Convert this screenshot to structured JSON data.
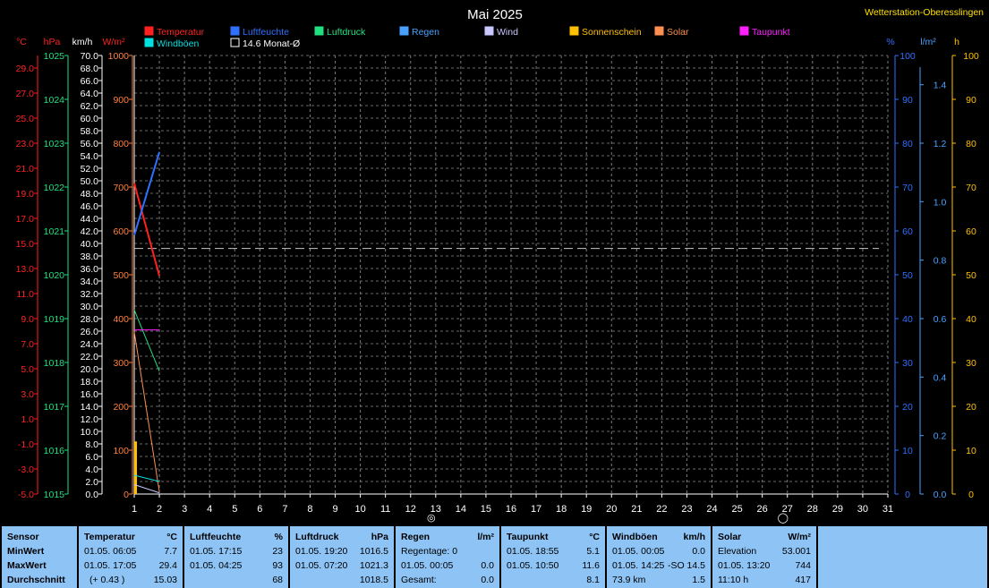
{
  "chart_data": {
    "type": "line",
    "title": "Mai 2025",
    "station": "Wetterstation-Oberesslingen",
    "x": {
      "categories": [
        "1",
        "2",
        "3",
        "4",
        "5",
        "6",
        "7",
        "8",
        "9",
        "10",
        "11",
        "12",
        "13",
        "14",
        "15",
        "16",
        "17",
        "18",
        "19",
        "20",
        "21",
        "22",
        "23",
        "24",
        "25",
        "26",
        "27",
        "28",
        "29",
        "30",
        "31"
      ],
      "range": [
        1,
        31
      ]
    },
    "axes_left": [
      {
        "unit": "°C",
        "color": "#ff2020",
        "min": -5,
        "max": 30,
        "ticks": [
          "-5.0",
          "-3.0",
          "-1.0",
          "1.0",
          "3.0",
          "5.0",
          "7.0",
          "9.0",
          "11.0",
          "13.0",
          "15.0",
          "17.0",
          "19.0",
          "21.0",
          "23.0",
          "25.0",
          "27.0",
          "29.0"
        ]
      },
      {
        "unit": "hPa",
        "color": "#20e080",
        "min": 1015,
        "max": 1025,
        "ticks": [
          "1015",
          "1016",
          "1017",
          "1018",
          "1019",
          "1020",
          "1021",
          "1022",
          "1023",
          "1024",
          "1025"
        ]
      },
      {
        "unit": "km/h",
        "color": "#ffffff",
        "min": 0,
        "max": 70,
        "ticks": [
          "0.0",
          "2.0",
          "4.0",
          "6.0",
          "8.0",
          "10.0",
          "12.0",
          "14.0",
          "16.0",
          "18.0",
          "20.0",
          "22.0",
          "24.0",
          "26.0",
          "28.0",
          "30.0",
          "32.0",
          "34.0",
          "36.0",
          "38.0",
          "40.0",
          "42.0",
          "44.0",
          "46.0",
          "48.0",
          "50.0",
          "52.0",
          "54.0",
          "56.0",
          "58.0",
          "60.0",
          "62.0",
          "64.0",
          "66.0",
          "68.0",
          "70.0"
        ]
      },
      {
        "unit": "W/m²",
        "color": "#ff8040",
        "min": 0,
        "max": 1000,
        "ticks": [
          "0",
          "100",
          "200",
          "300",
          "400",
          "500",
          "600",
          "700",
          "800",
          "900",
          "1000"
        ]
      }
    ],
    "axes_right": [
      {
        "unit": "%",
        "color": "#3070ff",
        "min": 0,
        "max": 100,
        "ticks": [
          "0",
          "10",
          "20",
          "30",
          "40",
          "50",
          "60",
          "70",
          "80",
          "90",
          "100"
        ]
      },
      {
        "unit": "l/m²",
        "color": "#4aa0ff",
        "min": 0,
        "max": 1.5,
        "ticks": [
          "0.0",
          "0.2",
          "0.4",
          "0.6",
          "0.8",
          "1.0",
          "1.2",
          "1.4"
        ]
      },
      {
        "unit": "h",
        "color": "#ffc000",
        "min": 0,
        "max": 100,
        "ticks": [
          "0",
          "10",
          "20",
          "30",
          "40",
          "50",
          "60",
          "70",
          "80",
          "90",
          "100"
        ]
      }
    ],
    "legend": [
      {
        "name": "Temperatur",
        "color": "#ff2020"
      },
      {
        "name": "Luftfeuchte",
        "color": "#3070ff"
      },
      {
        "name": "Luftdruck",
        "color": "#20e080"
      },
      {
        "name": "Regen",
        "color": "#4aa0ff"
      },
      {
        "name": "Wind",
        "color": "#c8c8ff"
      },
      {
        "name": "Sonnenschein",
        "color": "#ffc000"
      },
      {
        "name": "Solar",
        "color": "#ff9050"
      },
      {
        "name": "Taupunkt",
        "color": "#ff20ff"
      },
      {
        "name": "Windböen",
        "color": "#00e0e0"
      },
      {
        "name": "14.6 Monat-Ø",
        "color": "#000000"
      }
    ],
    "series": [
      {
        "name": "Temperatur",
        "axis": "°C",
        "x": [
          1,
          2
        ],
        "y": [
          19.8,
          12.4
        ]
      },
      {
        "name": "Luftfeuchte",
        "axis": "%",
        "x": [
          1,
          2
        ],
        "y": [
          59,
          78
        ]
      },
      {
        "name": "Luftdruck",
        "axis": "hPa",
        "x": [
          1,
          2
        ],
        "y": [
          1019.2,
          1017.8
        ]
      },
      {
        "name": "Solar",
        "axis": "W/m²",
        "x": [
          1,
          2
        ],
        "y": [
          370,
          5
        ]
      },
      {
        "name": "Windböen",
        "axis": "km/h",
        "x": [
          1,
          2
        ],
        "y": [
          3.0,
          2.0
        ]
      },
      {
        "name": "Wind",
        "axis": "km/h",
        "x": [
          1,
          2
        ],
        "y": [
          1.5,
          0.2
        ]
      },
      {
        "name": "Taupunkt",
        "axis": "°C",
        "x": [
          1,
          2
        ],
        "y": [
          8.1,
          8.1
        ]
      }
    ],
    "bars": [
      {
        "name": "Sonnenschein",
        "axis": "h",
        "x": 1,
        "y": 12
      }
    ],
    "monthly_average": {
      "name": "14.6 Monat-Ø",
      "axis": "°C",
      "y": 14.6
    },
    "day_markers": [
      {
        "x": 13,
        "symbol": "◎"
      },
      {
        "x": 27,
        "symbol": "◯"
      }
    ],
    "grid": true
  },
  "stats": {
    "row_labels": [
      "Sensor",
      "MinWert",
      "MaxWert",
      "Durchschnitt"
    ],
    "panels": [
      {
        "title": "Temperatur",
        "unit": "°C",
        "min": {
          "time": "01.05.  06:05",
          "value": "7.7"
        },
        "max": {
          "time": "01.05.  17:05",
          "value": "29.4"
        },
        "avg": {
          "time": "(+ 0.43 )",
          "value": "15.03"
        }
      },
      {
        "title": "Luftfeuchte",
        "unit": "%",
        "min": {
          "time": "01.05.  17:15",
          "value": "23"
        },
        "max": {
          "time": "01.05.  04:25",
          "value": "93"
        },
        "avg": {
          "time": "",
          "value": "68"
        }
      },
      {
        "title": "Luftdruck",
        "unit": "hPa",
        "min": {
          "time": "01.05.  19:20",
          "value": "1016.5"
        },
        "max": {
          "time": "01.05.  07:20",
          "value": "1021.3"
        },
        "avg": {
          "time": "",
          "value": "1018.5"
        }
      },
      {
        "title": "Regen",
        "unit": "l/m²",
        "min": {
          "time": "Regentage: 0",
          "value": ""
        },
        "max": {
          "time": "01.05.  00:05",
          "value": "0.0"
        },
        "avg": {
          "time": "Gesamt:",
          "value": "0.0"
        }
      },
      {
        "title": "Taupunkt",
        "unit": "°C",
        "min": {
          "time": "01.05.  18:55",
          "value": "5.1"
        },
        "max": {
          "time": "01.05.  10:50",
          "value": "11.6"
        },
        "avg": {
          "time": "",
          "value": "8.1"
        }
      },
      {
        "title": "Windböen",
        "unit": "km/h",
        "min": {
          "time": "01.05.  00:05",
          "value": "0.0"
        },
        "max": {
          "time": "01.05.  14:25",
          "value": "-SO 14.5"
        },
        "avg": {
          "time": "73.9 km",
          "value": "1.5"
        }
      },
      {
        "title": "Solar",
        "unit": "W/m²",
        "min": {
          "time": "Elevation",
          "value": "53.001"
        },
        "max": {
          "time": "01.05.  13:20",
          "value": "744"
        },
        "avg": {
          "time": "11:10 h",
          "value": "417"
        }
      }
    ]
  }
}
